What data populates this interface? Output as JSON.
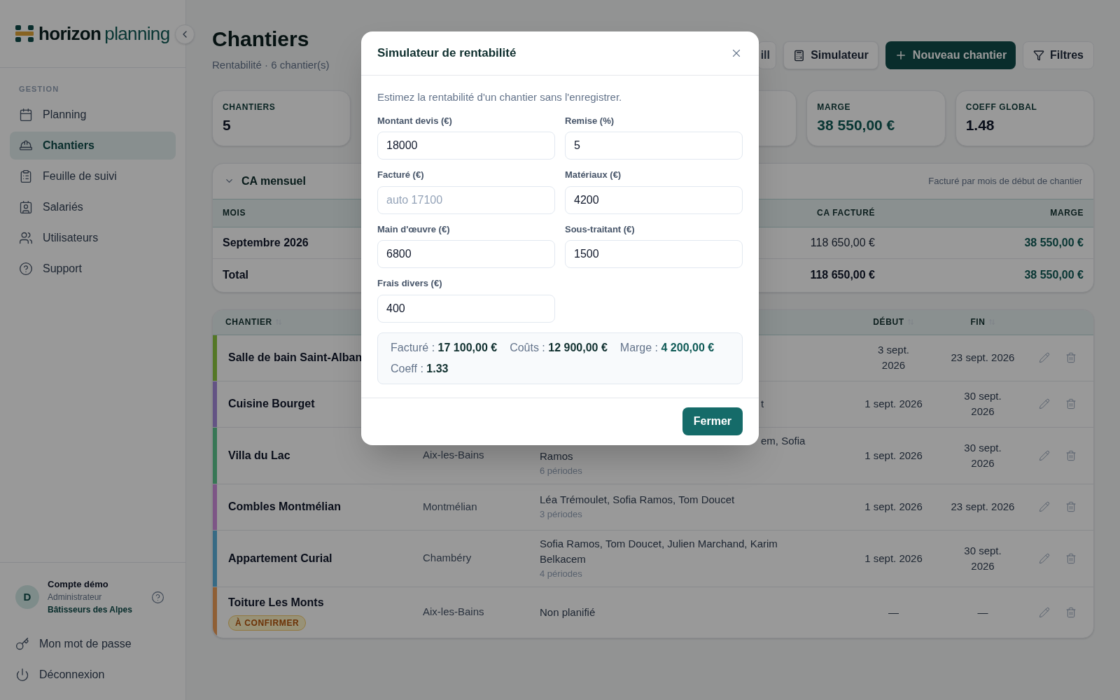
{
  "brand": {
    "word1": "horizon",
    "word2": "planning"
  },
  "sidebar": {
    "section": "GESTION",
    "items": [
      {
        "kind": "calendar",
        "label": "Planning",
        "selected": false
      },
      {
        "kind": "helmet",
        "label": "Chantiers",
        "selected": true
      },
      {
        "kind": "clipboard",
        "label": "Feuille de suivi",
        "selected": false
      },
      {
        "kind": "idcard",
        "label": "Salariés",
        "selected": false
      },
      {
        "kind": "users",
        "label": "Utilisateurs",
        "selected": false
      },
      {
        "kind": "help",
        "label": "Support",
        "selected": false
      }
    ],
    "account": {
      "initial": "D",
      "name": "Compte démo",
      "role": "Administrateur",
      "company": "Bâtisseurs des Alpes"
    },
    "footer_items": [
      {
        "kind": "key",
        "label": "Mon mot de passe"
      },
      {
        "kind": "power",
        "label": "Déconnexion"
      }
    ]
  },
  "page": {
    "title": "Chantiers",
    "subtitle": "Rentabilité · 6 chantier(s)"
  },
  "toolbar": [
    {
      "kind": "partial",
      "label": "ill"
    },
    {
      "kind": "calculator",
      "label": "Simulateur"
    },
    {
      "kind": "primary",
      "label": "Nouveau chantier"
    },
    {
      "kind": "filter",
      "label": "Filtres"
    }
  ],
  "stats": [
    {
      "kind": "number",
      "label": "CHANTIERS",
      "value": "5"
    },
    {
      "kind": "hidden"
    },
    {
      "kind": "money",
      "label": "MARGE",
      "value": "38 550,00 €"
    },
    {
      "kind": "number",
      "label": "COEFF GLOBAL",
      "value": "1.48"
    }
  ],
  "ca": {
    "title": "CA mensuel",
    "expanded": true,
    "note": "Facturé par mois de début de chantier",
    "columns": {
      "mois": "MOIS",
      "ca": "CA FACTURÉ",
      "marge": "MARGE"
    },
    "rows": [
      {
        "kind": "month",
        "mois": "Septembre 2026",
        "ca": "118 650,00 €",
        "marge": "38 550,00 €"
      },
      {
        "kind": "total",
        "mois": "Total",
        "ca": "118 650,00 €",
        "marge": "38 550,00 €"
      }
    ]
  },
  "table": {
    "columns": {
      "chantier": "CHANTIER",
      "debut": "DÉBUT",
      "fin": "FIN"
    },
    "rows": [
      {
        "name": "Salle de bain Saint-Alban",
        "color": "#547726",
        "debut": "3 sept.\n2026",
        "fin": "23 sept. 2026"
      },
      {
        "name": "Cuisine Bourget",
        "color": "#635384",
        "people_fragment": [
          "t"
        ],
        "debut": "1 sept. 2026",
        "fin": "30 sept.\n2026"
      },
      {
        "name": "Villa du Lac",
        "color": "#377655",
        "city": "Aix-les-Bains",
        "people_fragment": [
          "em, Sofia",
          "Ramos"
        ],
        "periods": "6 périodes",
        "debut": "1 sept. 2026",
        "fin": "30 sept.\n2026"
      },
      {
        "name": "Combles Montmélian",
        "color": "#7d5586",
        "city": "Montmélian",
        "people": "Léa Trémoulet, Sofia Ramos, Tom Doucet",
        "periods": "3 périodes",
        "debut": "1 sept. 2026",
        "fin": "23 sept. 2026"
      },
      {
        "name": "Appartement Curial",
        "color": "#376a84",
        "city": "Chambéry",
        "people": "Sofia Ramos, Tom Doucet, Julien Marchand, Karim Belkacem",
        "periods": "4 périodes",
        "debut": "1 sept. 2026",
        "fin": "30 sept.\n2026"
      },
      {
        "name": "Toiture Les Monts",
        "color": "#8f5f35",
        "badge": "À CONFIRMER",
        "city": "Aix-les-Bains",
        "people": "Non planifié",
        "debut": "—",
        "fin": "—"
      }
    ]
  },
  "modal": {
    "title": "Simulateur de rentabilité",
    "intro": "Estimez la rentabilité d'un chantier sans l'enregistrer.",
    "fields": [
      {
        "label": "Montant devis (€)",
        "value": "18000"
      },
      {
        "label": "Remise (%)",
        "value": "5"
      },
      {
        "label": "Facturé (€)",
        "placeholder": "auto 17100"
      },
      {
        "label": "Matériaux (€)",
        "value": "4200"
      },
      {
        "label": "Main d'œuvre (€)",
        "value": "6800"
      },
      {
        "label": "Sous-traitant (€)",
        "value": "1500"
      },
      {
        "label": "Frais divers (€)",
        "value": "400"
      }
    ],
    "summary": [
      {
        "kind": "plain",
        "label": "Facturé :",
        "value": "17 100,00 €"
      },
      {
        "kind": "plain",
        "label": "Coûts :",
        "value": "12 900,00 €"
      },
      {
        "kind": "accent",
        "label": "Marge :",
        "value": "4 200,00 €"
      },
      {
        "kind": "plain",
        "label": "Coeff :",
        "value": "1.33"
      }
    ],
    "button": "Fermer"
  }
}
